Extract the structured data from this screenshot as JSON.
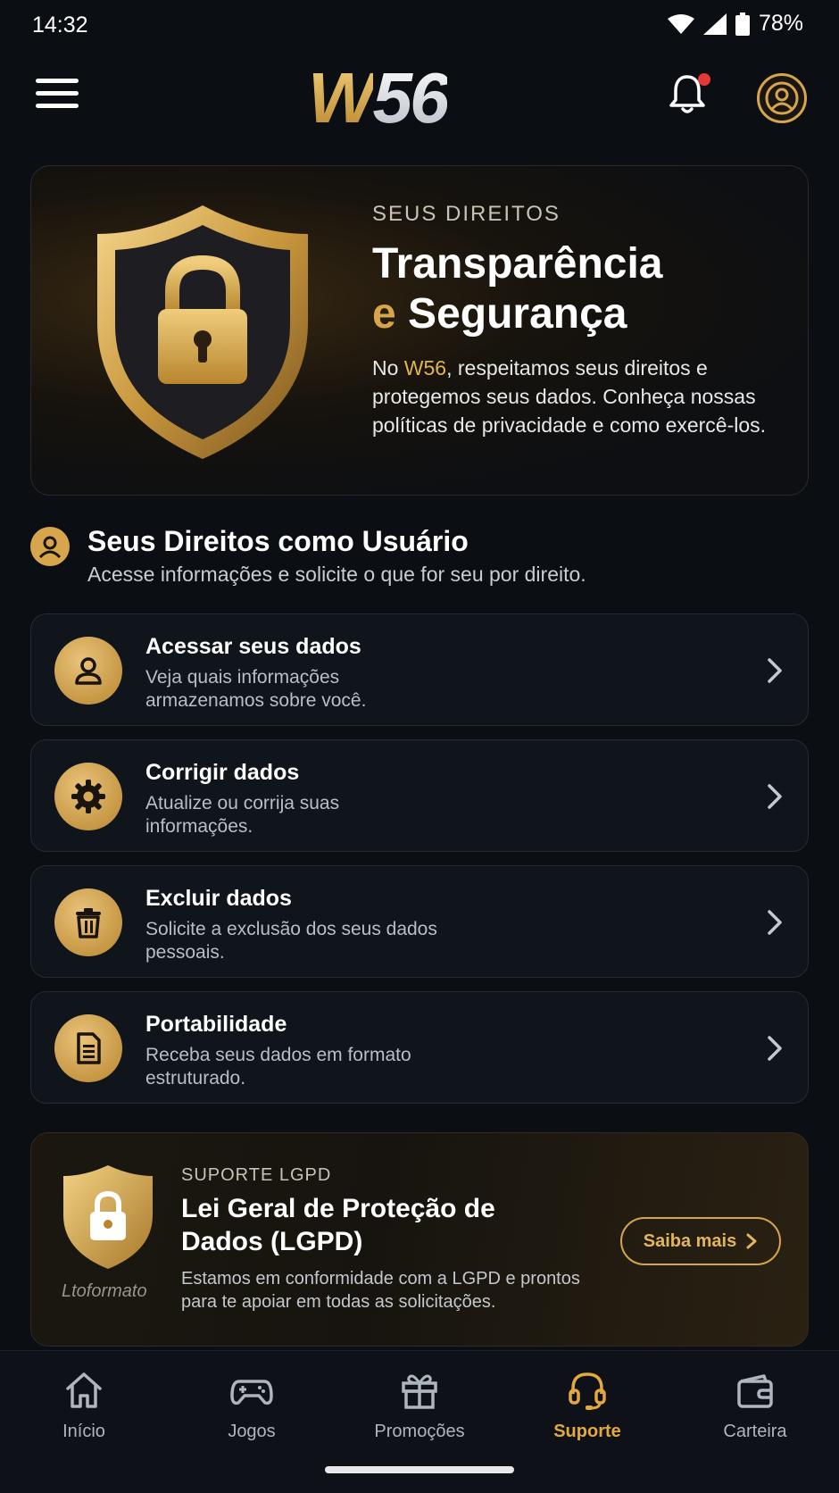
{
  "status_bar": {
    "time": "14:32",
    "battery": "78%"
  },
  "header": {
    "logo_w": "W",
    "logo_rest": "56"
  },
  "hero": {
    "kicker": "SEUS DIREITOS",
    "title_line1": "Transparência",
    "title_e": "e",
    "title_line2": "Segurança",
    "desc_pre": "No ",
    "desc_brand": "W56",
    "desc_post": ", respeitamos seus direitos e protegemos seus dados. Conheça nossas políticas de privacidade e como exercê-los."
  },
  "section": {
    "title": "Seus Direitos como Usuário",
    "subtitle": "Acesse informações e solicite o que for seu por direito."
  },
  "rights": [
    {
      "title": "Acessar seus dados",
      "desc": "Veja quais informações armazenamos sobre você.",
      "icon": "user-icon"
    },
    {
      "title": "Corrigir dados",
      "desc": "Atualize ou corrija suas informações.",
      "icon": "gear-icon"
    },
    {
      "title": "Excluir dados",
      "desc": "Solicite a exclusão dos seus dados pessoais.",
      "icon": "trash-icon"
    },
    {
      "title": "Portabilidade",
      "desc": "Receba seus dados em formato estruturado.",
      "icon": "document-icon"
    }
  ],
  "lgpd": {
    "kicker": "SUPORTE LGPD",
    "title": "Lei Geral de Proteção de Dados (LGPD)",
    "desc": "Estamos em conformidade com a LGPD e prontos para te apoiar em todas as solicitações.",
    "emblem_text": "Ltoformato",
    "button": "Saiba mais"
  },
  "nav": [
    {
      "label": "Início",
      "icon": "home-icon",
      "active": false
    },
    {
      "label": "Jogos",
      "icon": "gamepad-icon",
      "active": false
    },
    {
      "label": "Promoções",
      "icon": "gift-icon",
      "active": false
    },
    {
      "label": "Suporte",
      "icon": "headset-icon",
      "active": true
    },
    {
      "label": "Carteira",
      "icon": "wallet-icon",
      "active": false
    }
  ],
  "colors": {
    "accent": "#d6a54c",
    "active_nav": "#e3a93f",
    "background": "#0b0f14",
    "notification": "#e53935"
  }
}
